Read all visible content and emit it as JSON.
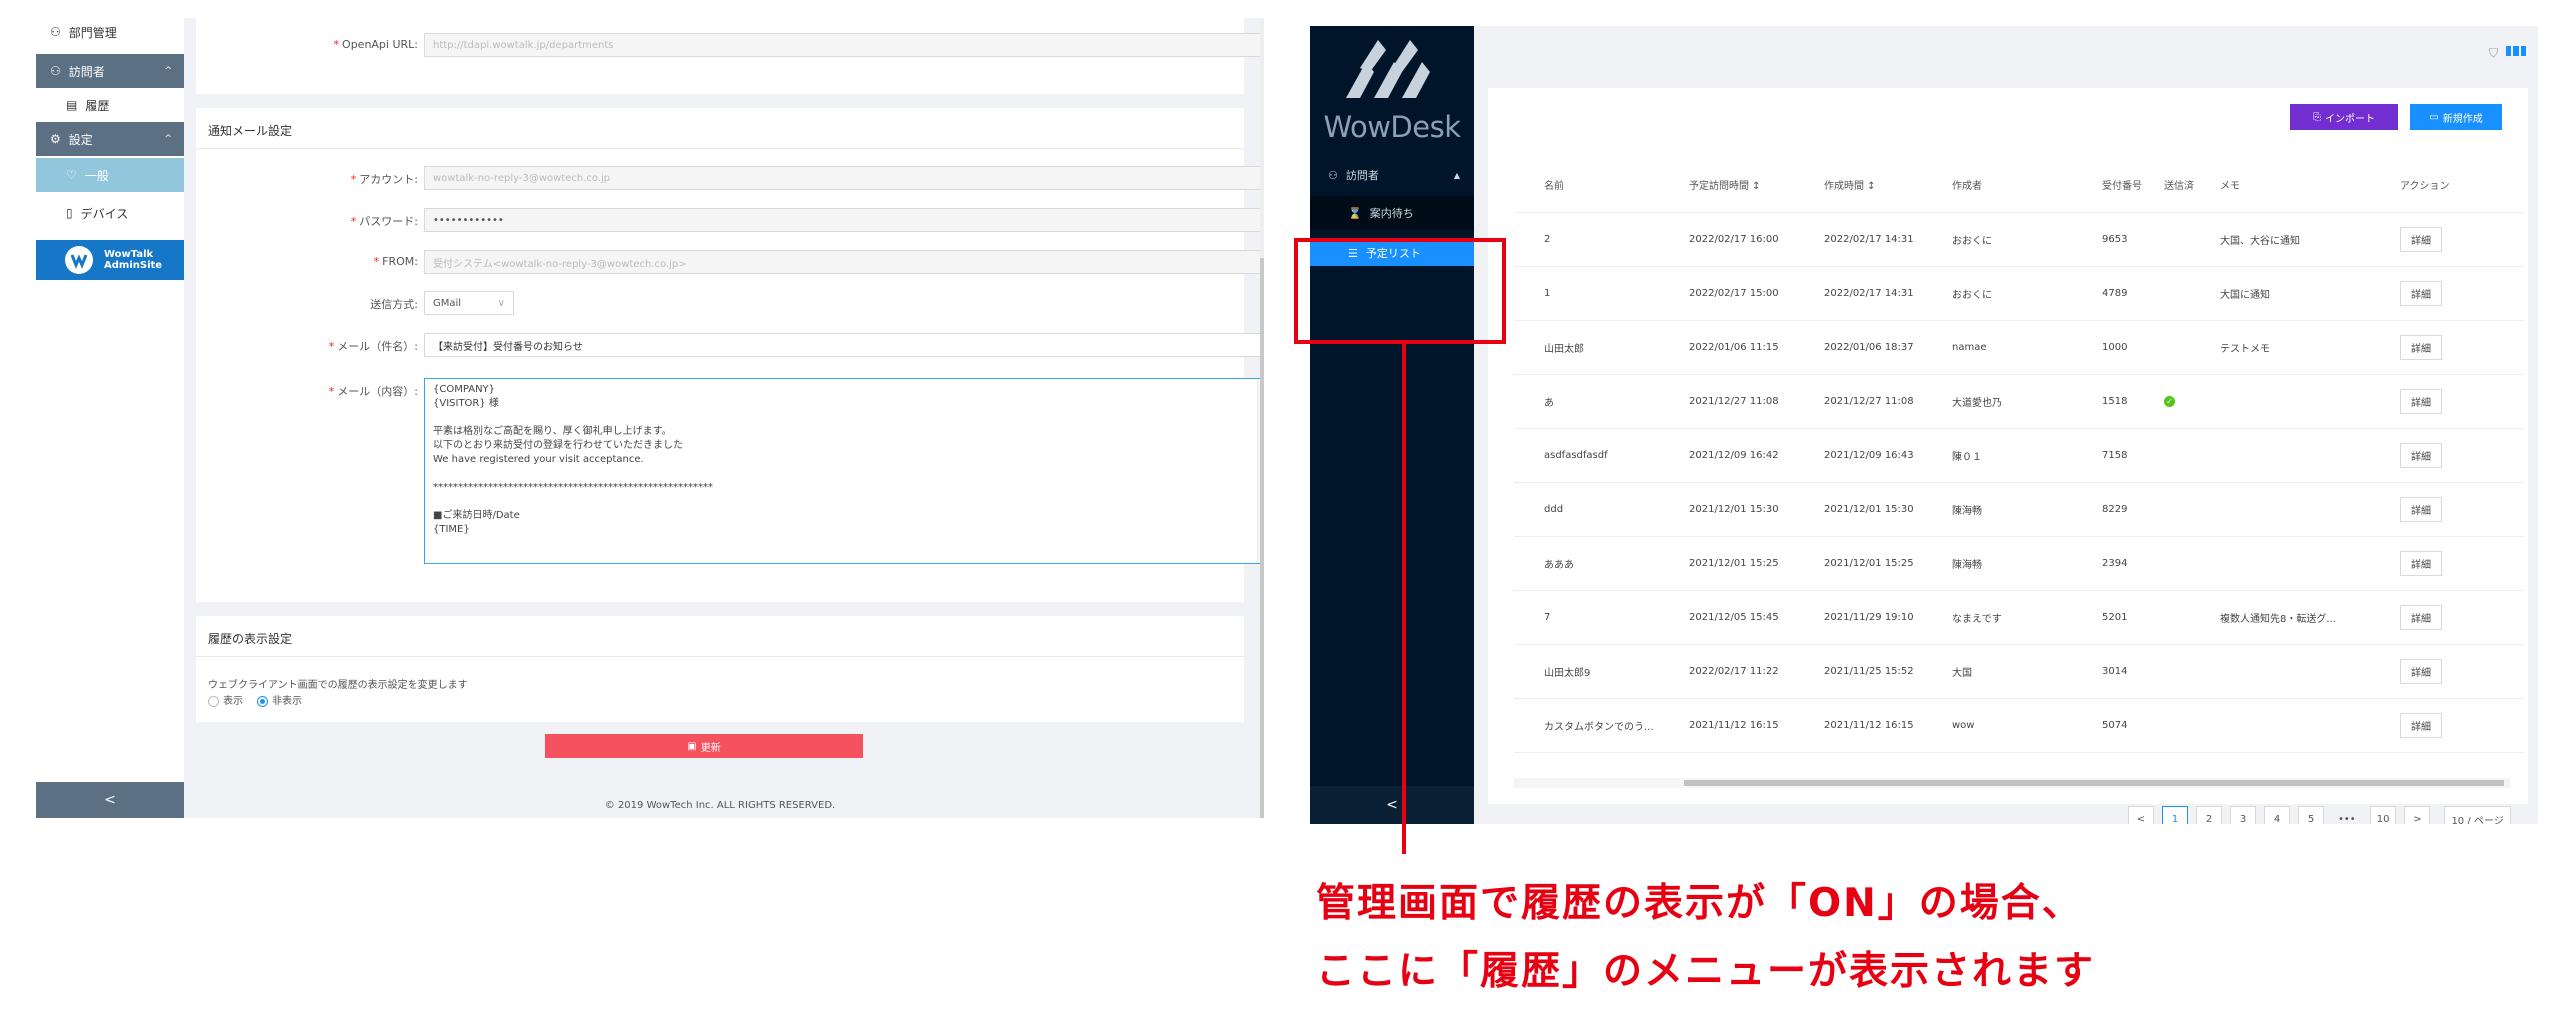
{
  "left": {
    "sidebar": {
      "items": [
        {
          "icon": "department-icon",
          "label": "部門管理"
        },
        {
          "icon": "visitor-icon",
          "label": "訪問者"
        },
        {
          "icon": "history-icon",
          "label": "履歴"
        },
        {
          "icon": "gear-icon",
          "label": "設定"
        },
        {
          "icon": "general-icon",
          "label": "一般"
        },
        {
          "icon": "device-icon",
          "label": "デバイス"
        }
      ],
      "admin_logo_line1": "WowTalk",
      "admin_logo_line2": "AdminSite",
      "collapse": "<"
    },
    "openapi": {
      "label": "OpenApi URL:",
      "placeholder": "http://tdapi.wowtalk.jp/departments"
    },
    "mail_section": {
      "title": "通知メール設定",
      "account_label": "アカウント:",
      "account_value": "wowtalk-no-reply-3@wowtech.co.jp",
      "password_label": "パスワード:",
      "password_value": "••••••••••••",
      "from_label": "FROM:",
      "from_value": "受付システム<wowtalk-no-reply-3@wowtech.co.jp>",
      "method_label": "送信方式:",
      "method_value": "GMail",
      "subject_label": "メール（件名）:",
      "subject_value": "【来訪受付】受付番号のお知らせ",
      "body_label": "メール（内容）:",
      "body_lines": [
        "{COMPANY}",
        "   {VISITOR} 様",
        "",
        "   平素は格別なご高配を賜り、厚く御礼申し上げます。",
        "   以下のとおり来訪受付の登録を行わせていただきました",
        "   We have registered your visit acceptance.",
        "",
        "   ********************************************************",
        "",
        "   ■ご来訪日時/Date",
        "   {TIME}"
      ]
    },
    "history_section": {
      "title": "履歴の表示設定",
      "desc": "ウェブクライアント画面での履歴の表示設定を変更します",
      "opt_show": "表示",
      "opt_hide": "非表示"
    },
    "update_button": "更新",
    "footer": "© 2019 WowTech Inc. ALL RIGHTS RESERVED."
  },
  "right": {
    "logo_text": "WowDesk",
    "sidebar": {
      "section": "訪問者",
      "items": [
        "案内待ち",
        "予定リスト"
      ],
      "collapse": "<"
    },
    "toolbar": {
      "import": "インポート",
      "create": "新規作成"
    },
    "table": {
      "headers": [
        "名前",
        "予定訪問時間 ↕",
        "作成時間 ↕",
        "作成者",
        "受付番号",
        "送信済",
        "メモ",
        "アクション"
      ],
      "rows": [
        [
          "2",
          "2022/02/17 16:00",
          "2022/02/17 14:31",
          "おおくに",
          "9653",
          "",
          "大国、大谷に通知",
          "詳細"
        ],
        [
          "1",
          "2022/02/17 15:00",
          "2022/02/17 14:31",
          "おおくに",
          "4789",
          "",
          "大国に通知",
          "詳細"
        ],
        [
          "山田太郎",
          "2022/01/06 11:15",
          "2022/01/06 18:37",
          "namae",
          "1000",
          "",
          "テストメモ",
          "詳細"
        ],
        [
          "あ",
          "2021/12/27 11:08",
          "2021/12/27 11:08",
          "大道愛也乃",
          "1518",
          "ok",
          "",
          "詳細"
        ],
        [
          "asdfasdfasdf",
          "2021/12/09 16:42",
          "2021/12/09 16:43",
          "陳０１",
          "7158",
          "",
          "",
          "詳細"
        ],
        [
          "ddd",
          "2021/12/01 15:30",
          "2021/12/01 15:30",
          "陳海畅",
          "8229",
          "",
          "",
          "詳細"
        ],
        [
          "あああ",
          "2021/12/01 15:25",
          "2021/12/01 15:25",
          "陳海畅",
          "2394",
          "",
          "",
          "詳細"
        ],
        [
          "7",
          "2021/12/05 15:45",
          "2021/11/29 19:10",
          "なまえです",
          "5201",
          "",
          "複数人通知先8・転送グ...",
          "詳細"
        ],
        [
          "山田太郎9",
          "2022/02/17 11:22",
          "2021/11/25 15:52",
          "大国",
          "3014",
          "",
          "",
          "詳細"
        ],
        [
          "カスタムボタンでのう...",
          "2021/11/12 16:15",
          "2021/11/12 16:15",
          "wow",
          "5074",
          "",
          "",
          "詳細"
        ]
      ]
    },
    "pagination": {
      "prev": "<",
      "pages": [
        "1",
        "2",
        "3",
        "4",
        "5"
      ],
      "ellipsis": "•••",
      "last": "10",
      "next": ">",
      "page_size": "10 / ページ"
    }
  },
  "annotation": {
    "line1": "管理画面で履歴の表示が「ON」の場合、",
    "line2": "ここに「履歴」のメニューが表示されます",
    "color": "#e60012"
  }
}
